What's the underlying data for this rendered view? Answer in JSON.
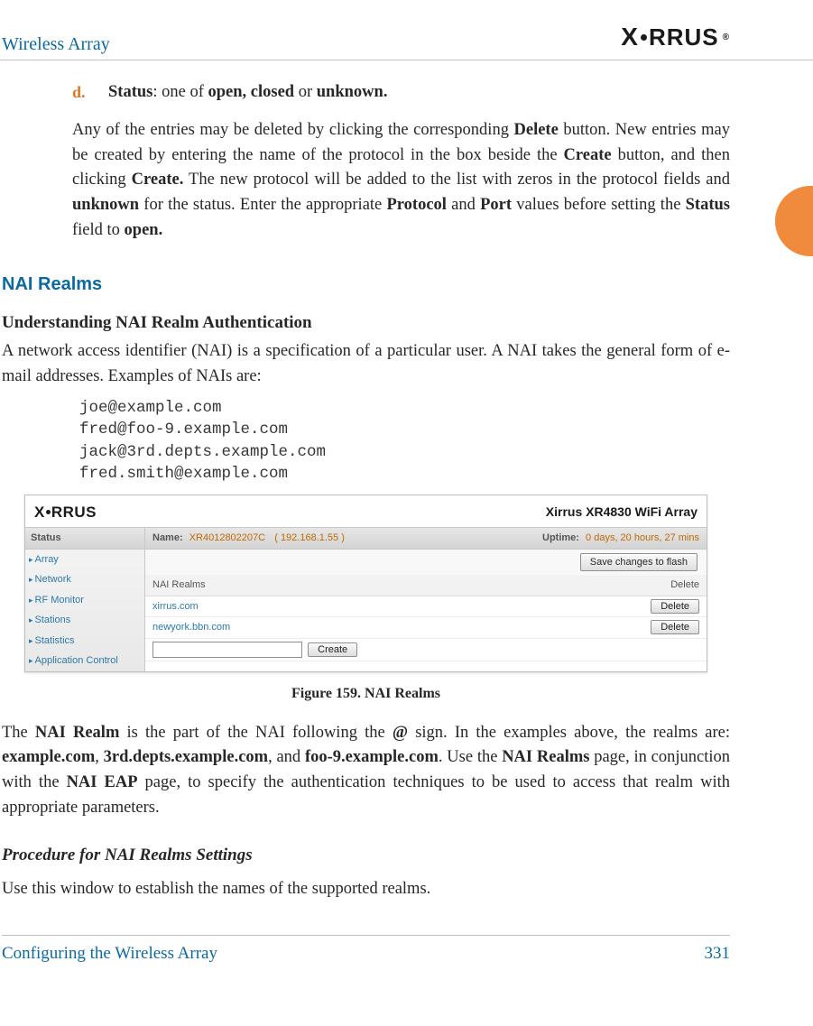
{
  "header": {
    "title": "Wireless Array",
    "logo_text": "XIRRUS",
    "logo_reg": "®"
  },
  "list_d": {
    "marker": "d.",
    "label": "Status",
    "sep": ": one of ",
    "opts": "open, closed",
    "or": " or ",
    "last": "unknown."
  },
  "para1": {
    "pre": "Any of the entries may be deleted by clicking the corresponding ",
    "b1": "Delete",
    "mid1": " button. New entries may be created by entering the name of the protocol in the box beside the ",
    "b2": "Create",
    "mid2": " button, and then clicking ",
    "b3": "Create.",
    "mid3": " The new protocol will be added to the list with zeros in the protocol fields and ",
    "b4": "unknown",
    "mid4": " for the status. Enter the appropriate ",
    "b5": "Protocol",
    "mid5": " and ",
    "b6": "Port",
    "mid6": " values before setting the ",
    "b7": "Status",
    "mid7": " field to ",
    "b8": "open."
  },
  "h_blue": "NAI Realms",
  "h_black": "Understanding NAI Realm Authentication",
  "para2": "A network access identifier (NAI) is a specification of a particular user. A NAI takes the general form of e-mail addresses. Examples of NAIs are:",
  "mono": [
    "joe@example.com",
    "fred@foo-9.example.com",
    "jack@3rd.depts.example.com",
    "fred.smith@example.com"
  ],
  "figure": {
    "product": "Xirrus XR4830 WiFi Array",
    "sidebar_head": "Status",
    "sidebar": [
      "Array",
      "Network",
      "RF Monitor",
      "Stations",
      "Statistics",
      "Application Control"
    ],
    "name_label": "Name:",
    "name_val": "XR4012802207C",
    "ip": "( 192.168.1.55 )",
    "uptime_label": "Uptime:",
    "uptime_val": "0 days, 20 hours, 27 mins",
    "save_btn": "Save changes to flash",
    "col1": "NAI Realms",
    "col2": "Delete",
    "rows": [
      "xirrus.com",
      "newyork.bbn.com"
    ],
    "delete_btn": "Delete",
    "create_btn": "Create",
    "caption": "Figure 159. NAI Realms"
  },
  "para3": {
    "p1": "The ",
    "b1": "NAI Realm",
    "p2": " is the part of the NAI following the ",
    "b2": "@",
    "p3": " sign. In the examples above, the realms are: ",
    "b3": "example.com",
    "c1": ", ",
    "b4": "3rd.depts.example.com",
    "c2": ", and ",
    "b5": "foo-9.example.com",
    "p4": ". Use the ",
    "b6": "NAI Realms",
    "p5": " page, in conjunction with the ",
    "b7": "NAI EAP",
    "p6": " page, to specify the authentication techniques to be used to access that realm with appropriate parameters."
  },
  "proc_h": "Procedure for NAI Realms Settings",
  "para4": "Use this window to establish the names of the supported realms.",
  "footer": {
    "left": "Configuring the Wireless Array",
    "right": "331"
  }
}
